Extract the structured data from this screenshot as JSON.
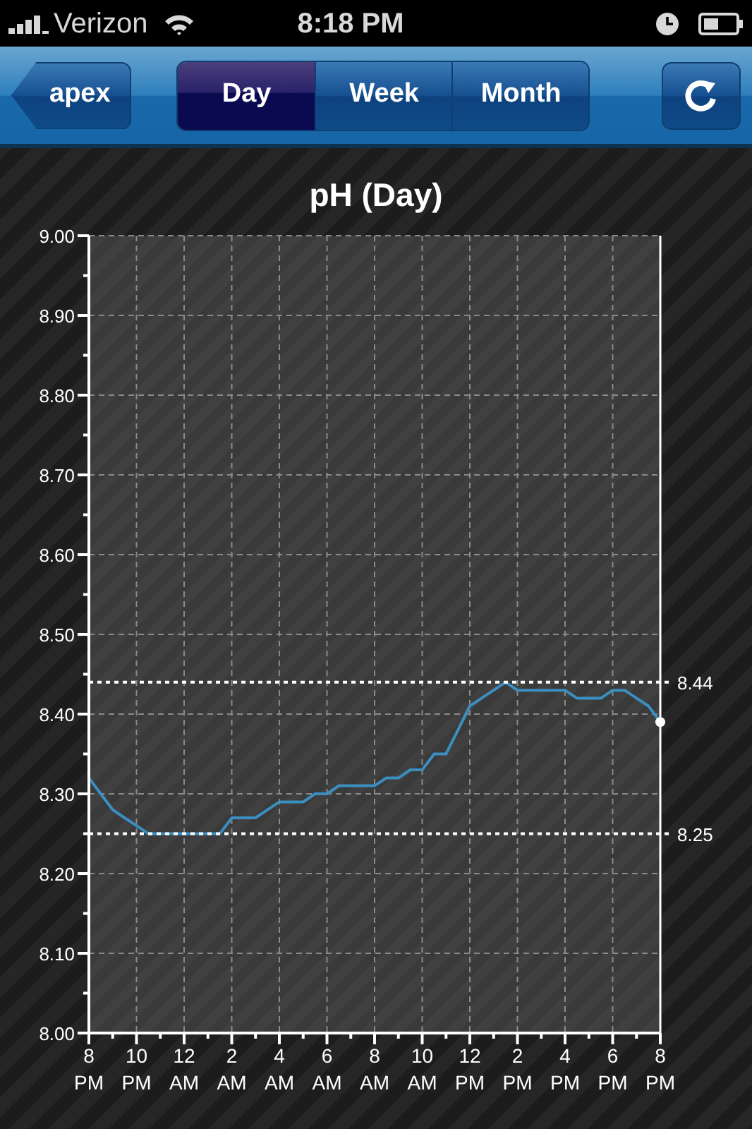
{
  "status_bar": {
    "carrier": "Verizon",
    "time": "8:18 PM"
  },
  "nav_bar": {
    "back_button": "apex",
    "segments": [
      {
        "label": "Day",
        "selected": true
      },
      {
        "label": "Week",
        "selected": false
      },
      {
        "label": "Month",
        "selected": false
      }
    ]
  },
  "chart": {
    "title": "pH (Day)",
    "chart_data": {
      "type": "line",
      "categories": [
        "8 PM",
        null,
        null,
        null,
        "10 PM",
        null,
        null,
        null,
        "12 AM",
        null,
        null,
        null,
        "2 AM",
        null,
        null,
        null,
        "4 AM",
        null,
        null,
        null,
        "6 AM",
        null,
        null,
        null,
        "8 AM",
        null,
        null,
        null,
        "10 AM",
        null,
        null,
        null,
        "12 PM",
        null,
        null,
        null,
        "2 PM",
        null,
        null,
        null,
        "4 PM",
        null,
        null,
        null,
        "6 PM",
        null,
        null,
        null,
        "8 PM"
      ],
      "series": [
        {
          "color": "#3a8fc0",
          "values": [
            8.32,
            8.3,
            8.28,
            8.27,
            8.26,
            8.25,
            8.25,
            8.25,
            8.25,
            8.25,
            8.25,
            8.25,
            8.27,
            8.27,
            8.27,
            8.28,
            8.29,
            8.29,
            8.29,
            8.3,
            8.3,
            8.31,
            8.31,
            8.31,
            8.31,
            8.32,
            8.32,
            8.33,
            8.33,
            8.35,
            8.35,
            8.38,
            8.41,
            8.42,
            8.43,
            8.44,
            8.43,
            8.43,
            8.43,
            8.43,
            8.43,
            8.42,
            8.42,
            8.42,
            8.43,
            8.43,
            8.42,
            8.41,
            8.39
          ]
        }
      ],
      "ylim": [
        8.0,
        9.0
      ],
      "yticks": [
        {
          "value": 8.0,
          "label": "8.00"
        },
        {
          "value": 8.1,
          "label": "8.10"
        },
        {
          "value": 8.2,
          "label": "8.20"
        },
        {
          "value": 8.3,
          "label": "8.30"
        },
        {
          "value": 8.4,
          "label": "8.40"
        },
        {
          "value": 8.5,
          "label": "8.50"
        },
        {
          "value": 8.6,
          "label": "8.60"
        },
        {
          "value": 8.7,
          "label": "8.70"
        },
        {
          "value": 8.8,
          "label": "8.80"
        },
        {
          "value": 8.9,
          "label": "8.90"
        },
        {
          "value": 9.0,
          "label": "9.00"
        }
      ],
      "grid": true,
      "ref_lines": [
        {
          "axis": "y",
          "value": 8.44,
          "label": "8.44"
        },
        {
          "axis": "y",
          "value": 8.25,
          "label": "8.25"
        }
      ]
    }
  }
}
